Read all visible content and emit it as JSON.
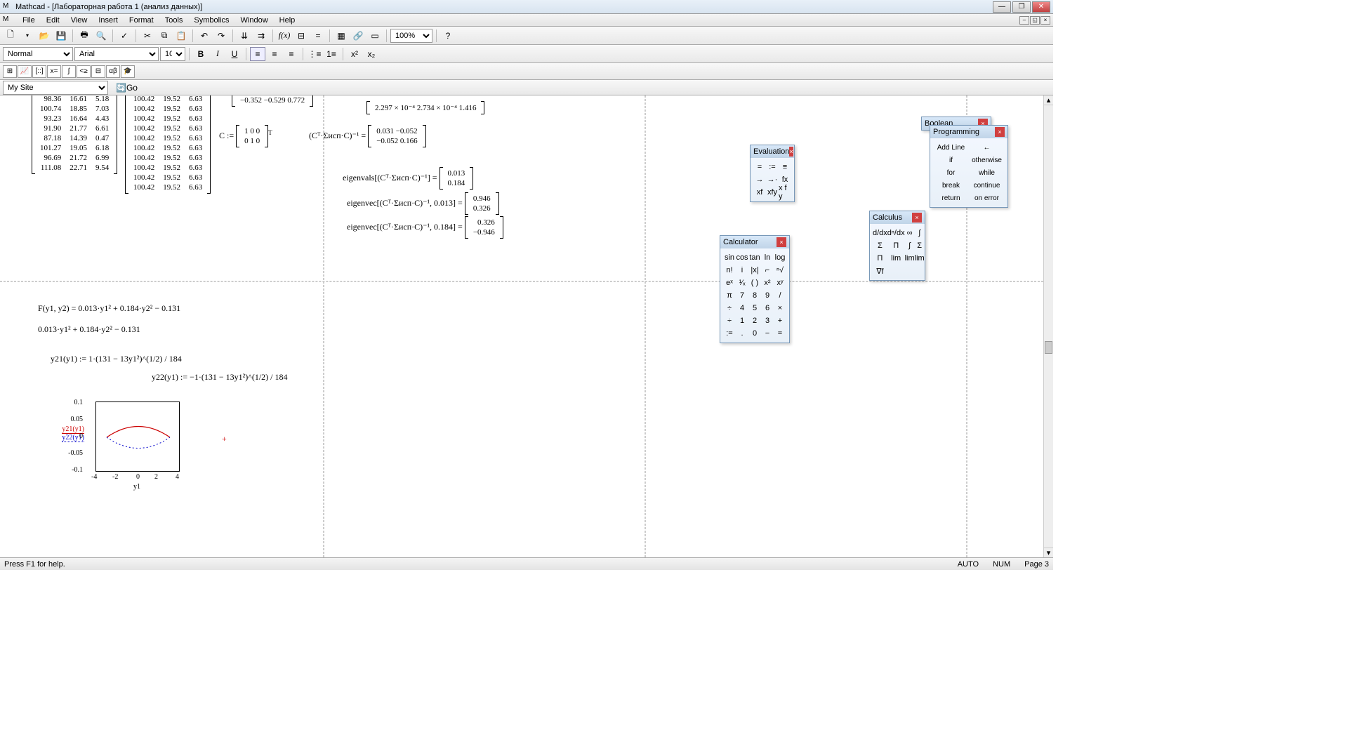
{
  "title": "Mathcad - [Лабораторная работа 1 (анализ данных)]",
  "menus": [
    "File",
    "Edit",
    "View",
    "Insert",
    "Format",
    "Tools",
    "Symbolics",
    "Window",
    "Help"
  ],
  "toolbar1_icons": [
    "new",
    "open",
    "save",
    "print",
    "preview",
    "spell",
    "cut",
    "copy",
    "paste",
    "undo",
    "redo",
    "align-h",
    "align-v",
    "fx",
    "units",
    "eval",
    "matrix",
    "graph",
    "region"
  ],
  "zoom": "100%",
  "style_select": "Normal",
  "font_select": "Arial",
  "size_select": "10",
  "nav_select": "My Site",
  "go_label": "Go",
  "matrix_left": [
    [
      "98.36",
      "16.61",
      "5.18"
    ],
    [
      "100.74",
      "18.85",
      "7.03"
    ],
    [
      "93.23",
      "16.64",
      "4.43"
    ],
    [
      "91.90",
      "21.77",
      "6.61"
    ],
    [
      "87.18",
      "14.39",
      "0.47"
    ],
    [
      "101.27",
      "19.05",
      "6.18"
    ],
    [
      "96.69",
      "21.72",
      "6.99"
    ],
    [
      "111.08",
      "22.71",
      "9.54"
    ]
  ],
  "matrix_mid": [
    [
      "100.42",
      "19.52",
      "6.63"
    ],
    [
      "100.42",
      "19.52",
      "6.63"
    ],
    [
      "100.42",
      "19.52",
      "6.63"
    ],
    [
      "100.42",
      "19.52",
      "6.63"
    ],
    [
      "100.42",
      "19.52",
      "6.63"
    ],
    [
      "100.42",
      "19.52",
      "6.63"
    ],
    [
      "100.42",
      "19.52",
      "6.63"
    ],
    [
      "100.42",
      "19.52",
      "6.63"
    ],
    [
      "100.42",
      "19.52",
      "6.63"
    ],
    [
      "100.42",
      "19.52",
      "6.63"
    ]
  ],
  "eq_c_top": "1  0  0",
  "eq_c_bot": "0  1  0",
  "eq_c_label": "C :=",
  "eq_cmatrix_neg": "−0.352  −0.529  0.772",
  "eq_inv_label": "(Cᵀ·Σисп·C)⁻¹ =",
  "eq_inv_r1": "0.031  −0.052",
  "eq_inv_r2": "−0.052  0.166",
  "eq_sigma_r": "2.297 × 10⁻⁴   2.734 × 10⁻⁴     1.416",
  "eq_eig_label": "eigenvals[(Cᵀ·Σисп·C)⁻¹] =",
  "eq_eig_v1": "0.013",
  "eq_eig_v2": "0.184",
  "eq_evec1_label": "eigenvec[(Cᵀ·Σисп·C)⁻¹, 0.013] =",
  "eq_evec1_v1": "0.946",
  "eq_evec1_v2": "0.326",
  "eq_evec2_label": "eigenvec[(Cᵀ·Σисп·C)⁻¹, 0.184] =",
  "eq_evec2_v1": "0.326",
  "eq_evec2_v2": "−0.946",
  "eq_F": "F(y1, y2) = 0.013·y1² + 0.184·y2² − 0.131",
  "eq_F2": "0.013·y1² + 0.184·y2² − 0.131",
  "eq_y21": "y21(y1) := 1·(131 − 13y1²)^(1/2) / 184",
  "eq_y22": "y22(y1) := −1·(131 − 13y1²)^(1/2) / 184",
  "chart_data": {
    "type": "line",
    "x": [
      -4,
      -3,
      -2,
      -1,
      0,
      1,
      2,
      3,
      4
    ],
    "series": [
      {
        "name": "y21(y1)",
        "style": "solid",
        "color": "#cc0000",
        "values": [
          null,
          -0.017,
          0.049,
          0.057,
          0.062,
          0.057,
          0.049,
          -0.017,
          null
        ]
      },
      {
        "name": "y22(y1)",
        "style": "dotted",
        "color": "#0000cc",
        "values": [
          null,
          0.017,
          -0.049,
          -0.057,
          -0.062,
          -0.057,
          -0.049,
          0.017,
          null
        ]
      }
    ],
    "xlabel": "y1",
    "ylabel": "",
    "xlim": [
      -4,
      4
    ],
    "ylim": [
      -0.1,
      0.1
    ],
    "yticks": [
      -0.1,
      -0.05,
      0,
      0.05,
      0.1
    ],
    "xticks": [
      -4,
      -2,
      0,
      2,
      4
    ]
  },
  "chart_legend": [
    "y21(y1)",
    "y22(y1)"
  ],
  "palettes": {
    "evaluation": {
      "title": "Evaluation",
      "btns": [
        "=",
        ":=",
        "≡",
        "→",
        "→·",
        "fx",
        "xf",
        "xfy",
        "x f y"
      ]
    },
    "calculator": {
      "title": "Calculator",
      "btns": [
        "sin",
        "cos",
        "tan",
        "ln",
        "log",
        "n!",
        "i",
        "|x|",
        "⌐",
        "ⁿ√",
        "eˣ",
        "¹⁄ₓ",
        "( )",
        "x²",
        "xʸ",
        "π",
        "7",
        "8",
        "9",
        "/",
        "÷",
        "4",
        "5",
        "6",
        "×",
        "÷",
        "1",
        "2",
        "3",
        "+",
        ":=",
        ".",
        "0",
        "−",
        "="
      ]
    },
    "calculus": {
      "title": "Calculus",
      "btns": [
        "d/dx",
        "dⁿ/dx",
        "∞",
        "∫",
        "Σ",
        "Π",
        "∫",
        "Σ",
        "Π",
        "lim",
        "lim",
        "lim",
        "∇f"
      ]
    },
    "programming": {
      "title": "Programming",
      "btns": [
        "Add Line",
        "←",
        "if",
        "otherwise",
        "for",
        "while",
        "break",
        "continue",
        "return",
        "on error"
      ]
    },
    "boolean": {
      "title": "Boolean"
    }
  },
  "status_left": "Press F1 for help.",
  "status_auto": "AUTO",
  "status_num": "NUM",
  "status_page": "Page 3"
}
